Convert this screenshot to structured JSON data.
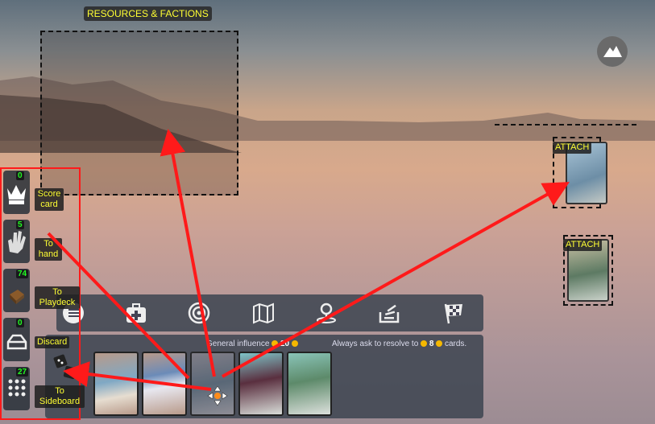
{
  "zones": {
    "resources_label": "RESOURCES & FACTIONS",
    "attach_label_1": "ATTACH",
    "attach_label_2": "ATTACH"
  },
  "piles": [
    {
      "count": "0",
      "label": "Score card",
      "icon": "crown-icon"
    },
    {
      "count": "5",
      "label": "To hand",
      "icon": "hand-icon"
    },
    {
      "count": "74",
      "label": "To Playdeck",
      "icon": "deck-icon"
    },
    {
      "count": "0",
      "label": "Discard",
      "icon": "tray-icon"
    },
    {
      "count": "27",
      "label": "To Sideboard",
      "icon": "grid-icon"
    }
  ],
  "toolbar": {
    "icons": [
      "deck-list-icon",
      "first-aid-icon",
      "target-icon",
      "map-icon",
      "location-pin-icon",
      "stack-icon",
      "checkered-flag-icon"
    ]
  },
  "hand": {
    "general_influence_label": "General influence",
    "general_influence_value": "20",
    "always_ask_label": "Always ask to resolve to",
    "always_ask_value": "8",
    "always_ask_suffix": "cards."
  },
  "colors": {
    "arrow": "#ff1a1a",
    "label_text": "#ffff33",
    "count_text": "#22ff22",
    "coin": "#f5b800"
  }
}
